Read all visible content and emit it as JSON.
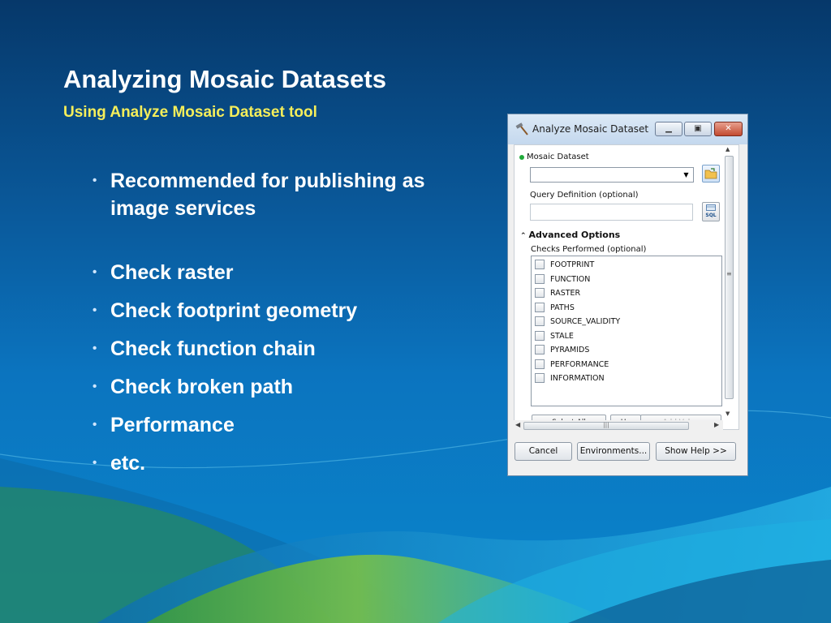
{
  "slide": {
    "title": "Analyzing Mosaic Datasets",
    "subtitle": "Using Analyze Mosaic Dataset tool",
    "bullets": [
      "Recommended for publishing as image services",
      "Check raster",
      "Check footprint geometry",
      "Check function chain",
      "Check broken path",
      "Performance",
      "etc."
    ],
    "bullet_glyph": "•"
  },
  "dialog": {
    "title": "Analyze Mosaic Dataset",
    "title_icon": "hammer-icon",
    "window_buttons": {
      "minimize": "▁",
      "maximize": "▣",
      "close": "✕"
    },
    "mosaic_dataset_label": "Mosaic Dataset",
    "mosaic_dataset_value": "",
    "query_definition_label": "Query Definition (optional)",
    "query_definition_value": "",
    "sql_button_label": "SQL",
    "advanced_options_label": "Advanced Options",
    "advanced_options_icon": "double-chevron-up-icon",
    "checks_label": "Checks Performed (optional)",
    "checks": [
      "FOOTPRINT",
      "FUNCTION",
      "RASTER",
      "PATHS",
      "SOURCE_VALIDITY",
      "STALE",
      "PYRAMIDS",
      "PERFORMANCE",
      "INFORMATION"
    ],
    "partial_buttons": [
      "Select All",
      "Un",
      "Add Value"
    ],
    "footer_buttons": {
      "cancel": "Cancel",
      "environments": "Environments...",
      "show_help": "Show Help >>"
    },
    "colors": {
      "required_dot": "#1faa3a",
      "close_button": "#c24a30",
      "subtitle": "#f5ee5a"
    }
  }
}
